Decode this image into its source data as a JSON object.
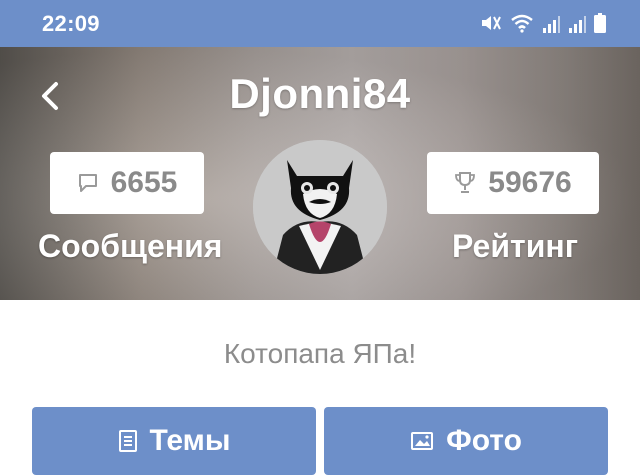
{
  "status_bar": {
    "time": "22:09",
    "icons": [
      "mute-icon",
      "wifi-icon",
      "signal-icon",
      "signal-icon",
      "battery-icon"
    ]
  },
  "profile": {
    "username": "Djonni84",
    "messages": {
      "count": "6655",
      "label": "Сообщения",
      "icon": "comment-icon"
    },
    "rating": {
      "count": "59676",
      "label": "Рейтинг",
      "icon": "trophy-icon"
    },
    "status_text": "Котопапа ЯПа!"
  },
  "actions": {
    "topics_label": "Темы",
    "photos_label": "Фото"
  },
  "colors": {
    "accent": "#6d8fc9",
    "stat_text": "#8a8a8a"
  }
}
